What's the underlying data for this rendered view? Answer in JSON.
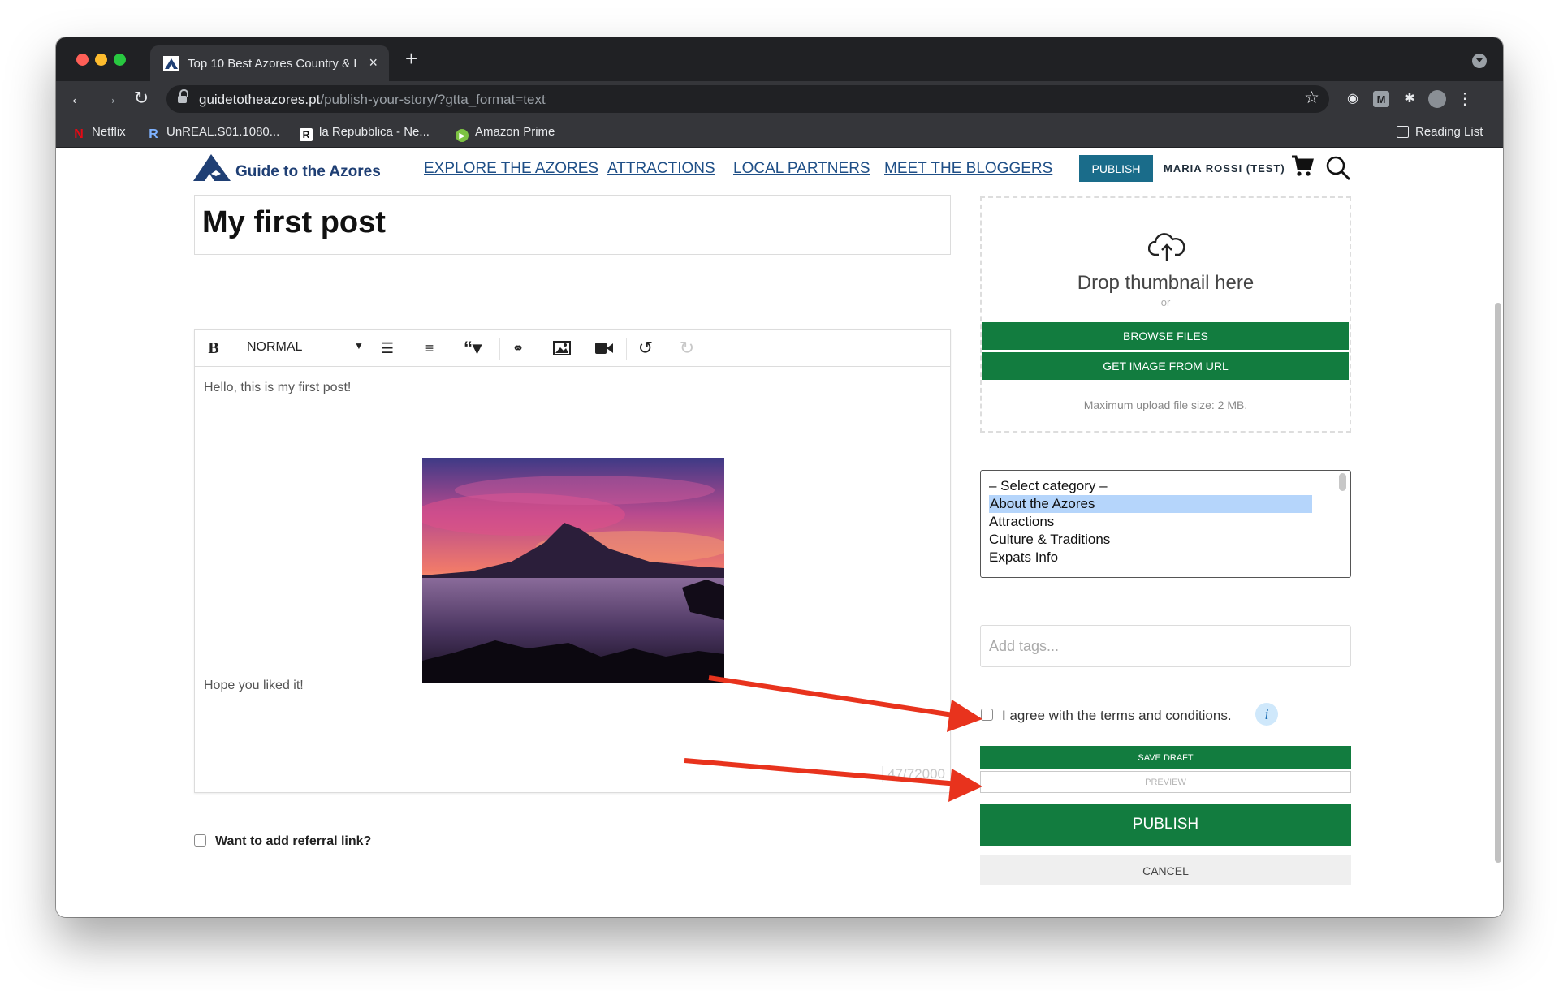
{
  "browser": {
    "tab_title": "Top 10 Best Azores Country & I",
    "tab_close": "×",
    "new_tab": "+",
    "url_host": "guidetotheazores.pt",
    "url_path": "/publish-your-story/?gtta_format=text",
    "bookmarks": [
      "Netflix",
      "UnREAL.S01.1080...",
      "la Repubblica - Ne...",
      "Amazon Prime"
    ],
    "reading_list": "Reading List",
    "icons": {
      "back": "arrow-left-icon",
      "forward": "arrow-right-icon",
      "reload": "reload-icon",
      "star": "star-icon"
    }
  },
  "site": {
    "logo_text": "Guide to the Azores",
    "nav": [
      "EXPLORE THE AZORES",
      "ATTRACTIONS",
      "LOCAL PARTNERS",
      "MEET THE BLOGGERS"
    ],
    "publish_button": "PUBLISH",
    "user_name": "MARIA ROSSI (TEST)"
  },
  "editor": {
    "title": "My first post",
    "bold_label": "B",
    "format_select": "NORMAL",
    "line1": "Hello, this is my first post!",
    "line2": "Hope you liked it!",
    "counter": "47/72000"
  },
  "referral": {
    "label": "Want to add referral link?"
  },
  "thumbnail": {
    "drop_title": "Drop thumbnail here",
    "or": "or",
    "browse": "BROWSE FILES",
    "from_url": "GET IMAGE FROM URL",
    "note": "Maximum upload file size: 2 MB."
  },
  "categories": {
    "options": [
      "– Select category –",
      "About the Azores",
      "Attractions",
      "Culture & Traditions",
      "Expats Info"
    ],
    "selected": "About the Azores"
  },
  "tags": {
    "placeholder": "Add tags..."
  },
  "terms": {
    "label": "I agree with the terms and conditions.",
    "info": "i"
  },
  "actions": {
    "save_draft": "SAVE DRAFT",
    "preview": "PREVIEW",
    "publish": "PUBLISH",
    "cancel": "CANCEL"
  },
  "colors": {
    "primary_green": "#127c3f",
    "publish_blue": "#1a6c8a",
    "nav_link": "#1f4f87",
    "annotation_arrow": "#e8331d"
  }
}
